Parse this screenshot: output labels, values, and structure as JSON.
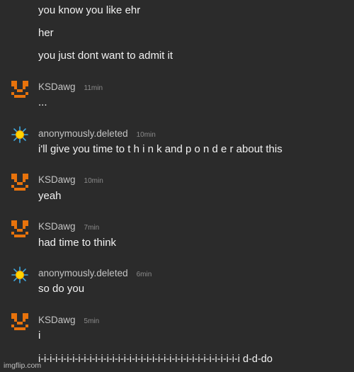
{
  "messages": [
    {
      "type": "continuation",
      "text": "you know you like ehr"
    },
    {
      "type": "continuation",
      "text": "her"
    },
    {
      "type": "continuation",
      "text": "you just dont want to admit it"
    },
    {
      "type": "message",
      "username": "KSDawg",
      "time": "11min",
      "avatar": "orange-pixel-face-icon",
      "text": "..."
    },
    {
      "type": "message",
      "username": "anonymously.deleted",
      "time": "10min",
      "avatar": "sun-starburst-icon",
      "text": "i'll give you time to t h i n k and p o n d e r about this"
    },
    {
      "type": "message",
      "username": "KSDawg",
      "time": "10min",
      "avatar": "orange-pixel-face-icon",
      "text": "yeah"
    },
    {
      "type": "message",
      "username": "KSDawg",
      "time": "7min",
      "avatar": "orange-pixel-face-icon",
      "text": "had time to think"
    },
    {
      "type": "message",
      "username": "anonymously.deleted",
      "time": "6min",
      "avatar": "sun-starburst-icon",
      "text": "so do you"
    },
    {
      "type": "message",
      "username": "KSDawg",
      "time": "5min",
      "avatar": "orange-pixel-face-icon",
      "text": "i"
    },
    {
      "type": "continuation",
      "text": "i-i-i-i-i-i-i-i-i-i-i-i-i-i-i-i-i-i-i-i-i-i-i-i-i-i-i-i-i-i-i-i-i-i-i-i d-d-do"
    }
  ],
  "watermark": "imgflip.com",
  "colors": {
    "background": "#2b2b2b",
    "message_text": "#f2f2f2",
    "username": "#c4c4c4",
    "timestamp": "#8c8c8c",
    "ksdawg_avatar": "#e8730c",
    "anon_avatar_core": "#ffd400",
    "anon_avatar_rays": "#3fa9e0"
  }
}
